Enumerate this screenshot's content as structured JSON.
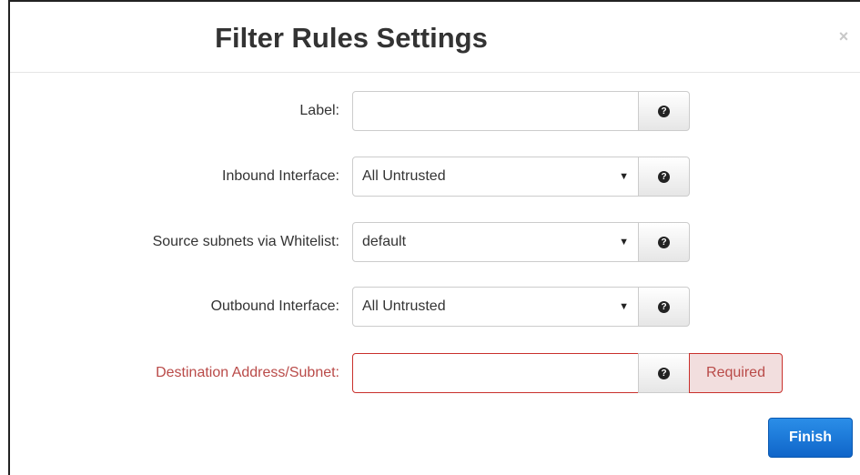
{
  "dialog": {
    "title": "Filter Rules Settings",
    "close_label": "×"
  },
  "form": {
    "label_field": {
      "label": "Label:",
      "value": "",
      "placeholder": ""
    },
    "inbound_interface": {
      "label": "Inbound Interface:",
      "selected": "All Untrusted"
    },
    "source_subnets": {
      "label": "Source subnets via Whitelist:",
      "selected": "default"
    },
    "outbound_interface": {
      "label": "Outbound Interface:",
      "selected": "All Untrusted"
    },
    "destination": {
      "label": "Destination Address/Subnet:",
      "value": "",
      "validation": "Required"
    }
  },
  "help_icon_glyph": "?",
  "caret_glyph": "▼",
  "actions": {
    "finish_label": "Finish"
  },
  "colors": {
    "error_text": "#b94a48",
    "error_border": "#c9302c",
    "error_bg": "#f2dede",
    "primary": "#0f65c9"
  }
}
